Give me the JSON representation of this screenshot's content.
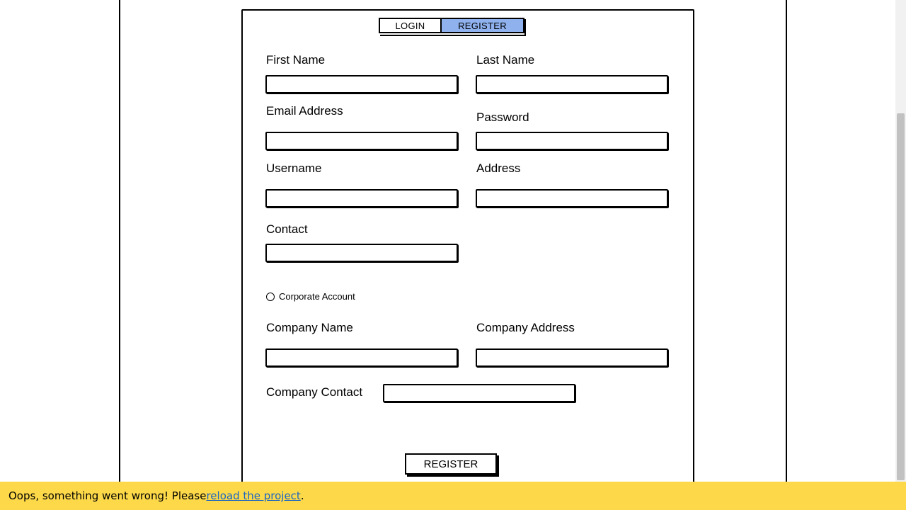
{
  "tabs": {
    "login": "LOGIN",
    "register": "REGISTER"
  },
  "fields": {
    "first_name": {
      "label": "First Name",
      "value": ""
    },
    "last_name": {
      "label": "Last Name",
      "value": ""
    },
    "email": {
      "label": "Email Address",
      "value": ""
    },
    "password": {
      "label": "Password",
      "value": ""
    },
    "username": {
      "label": "Username",
      "value": ""
    },
    "address": {
      "label": "Address",
      "value": ""
    },
    "contact": {
      "label": "Contact",
      "value": ""
    },
    "company_name": {
      "label": "Company Name",
      "value": ""
    },
    "company_address": {
      "label": "Company Address",
      "value": ""
    },
    "company_contact": {
      "label": "Company Contact",
      "value": ""
    }
  },
  "corporate": {
    "label": "Corporate Account",
    "checked": false
  },
  "submit_label": "REGISTER",
  "error": {
    "prefix": "Oops, something went wrong! Please ",
    "link": "reload the project",
    "suffix": "."
  },
  "colors": {
    "active_tab": "#8fb2ee",
    "error_bar": "#fdd94a",
    "link": "#1a66c2"
  }
}
